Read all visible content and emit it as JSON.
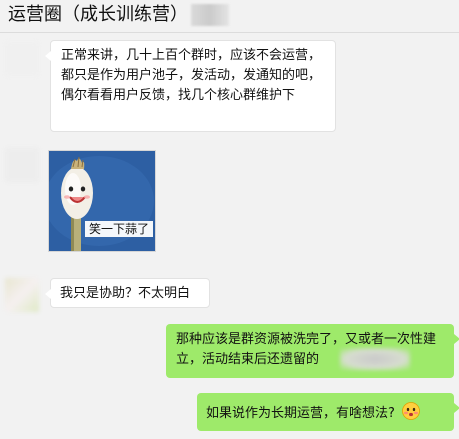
{
  "chat": {
    "title": "运营圈（成长训练营）"
  },
  "messages": [
    {
      "side": "left",
      "text": "正常来讲，几十上百个群时，应该不会运营，都只是作为用户池子，发活动，发通知的吧，偶尔看看用户反馈，找几个核心群维护下"
    },
    {
      "side": "left",
      "type": "sticker",
      "caption": "笑一下蒜了",
      "icon": "laughing-garlic-sticker"
    },
    {
      "side": "left",
      "text": "我只是协助？不太明白"
    },
    {
      "side": "right",
      "text": "那种应该是群资源被洗完了，又或者一次性建立，活动结束后还遗留的"
    },
    {
      "side": "right",
      "text": "如果说作为长期运营，有啥想法?",
      "emoji": "blushing-face-emoji"
    }
  ],
  "colors": {
    "background": "#f2f2f2",
    "left_bubble": "#ffffff",
    "right_bubble": "#9eea6a",
    "sticker_bg": "#2d5fa3"
  }
}
